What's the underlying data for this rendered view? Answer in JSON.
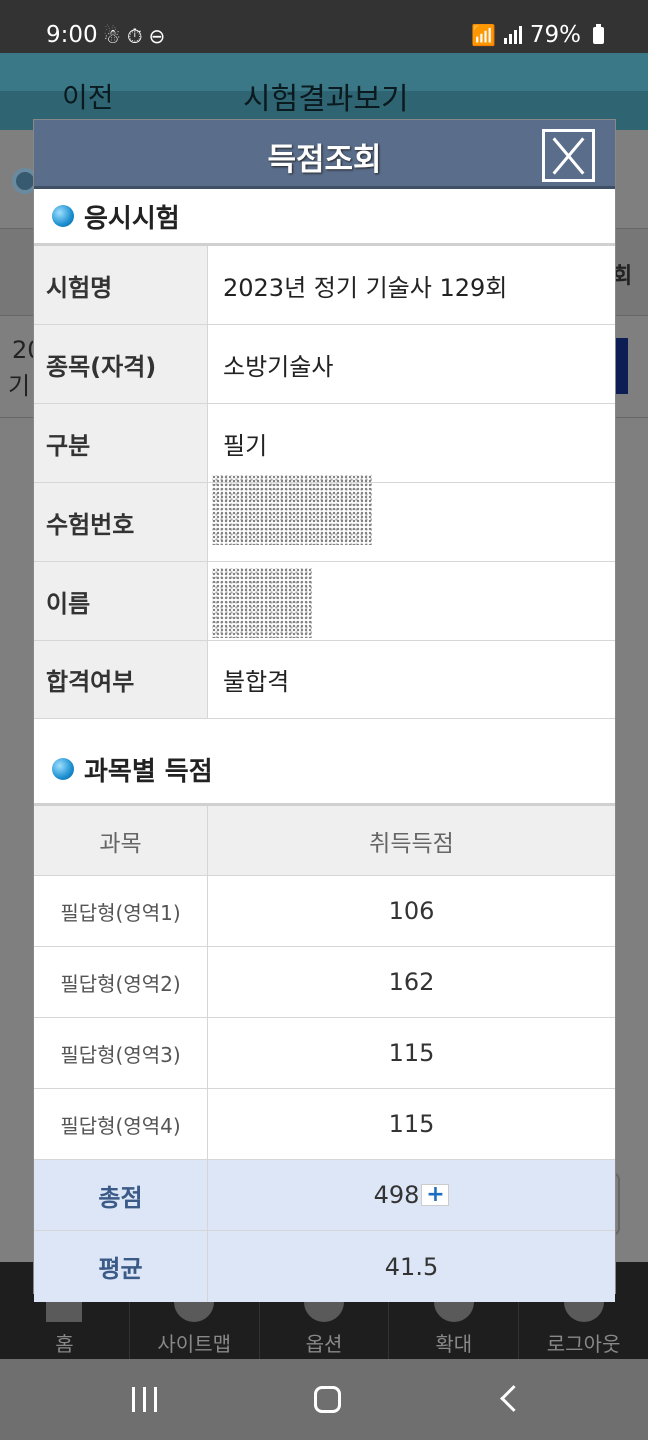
{
  "status_bar": {
    "time": "9:00",
    "battery": "79%",
    "left_icons": [
      "notification-icon",
      "timer-icon",
      "do-not-disturb-icon"
    ],
    "right_icons": [
      "wifi-icon",
      "signal-icon",
      "battery-icon"
    ]
  },
  "background_page": {
    "back_label": "이전",
    "title": "시험결과보기",
    "round_header_fragment": "회",
    "row_fragment_1": "20",
    "row_fragment_2": "기"
  },
  "tabbar": {
    "items": [
      {
        "label": "홈",
        "icon": "home-icon"
      },
      {
        "label": "사이트맵",
        "icon": "globe-icon"
      },
      {
        "label": "옵션",
        "icon": "gear-icon"
      },
      {
        "label": "확대",
        "icon": "zoom-plus-icon"
      },
      {
        "label": "로그아웃",
        "icon": "power-icon"
      }
    ]
  },
  "modal": {
    "title": "득점조회",
    "close_icon": "close-icon",
    "section1_title": "응시시험",
    "info": {
      "exam_name_label": "시험명",
      "exam_name": "2023년 정기 기술사 129회",
      "category_label": "종목(자격)",
      "category": "소방기술사",
      "type_label": "구분",
      "type": "필기",
      "exam_number_label": "수험번호",
      "name_label": "이름",
      "result_label": "합격여부",
      "result": "불합격"
    },
    "section2_title": "과목별 득점",
    "score_table": {
      "header_subject": "과목",
      "header_score": "취득득점",
      "rows": [
        {
          "subject": "필답형(영역1)",
          "score": "106"
        },
        {
          "subject": "필답형(영역2)",
          "score": "162"
        },
        {
          "subject": "필답형(영역3)",
          "score": "115"
        },
        {
          "subject": "필답형(영역4)",
          "score": "115"
        }
      ],
      "total_label": "총점",
      "total_value": "498",
      "total_plus": "+",
      "average_label": "평균",
      "average_value": "41.5"
    }
  },
  "colors": {
    "modal_header": "#5a6e8c",
    "total_row_bg": "#dde6f6",
    "total_label": "#3a5a88"
  }
}
